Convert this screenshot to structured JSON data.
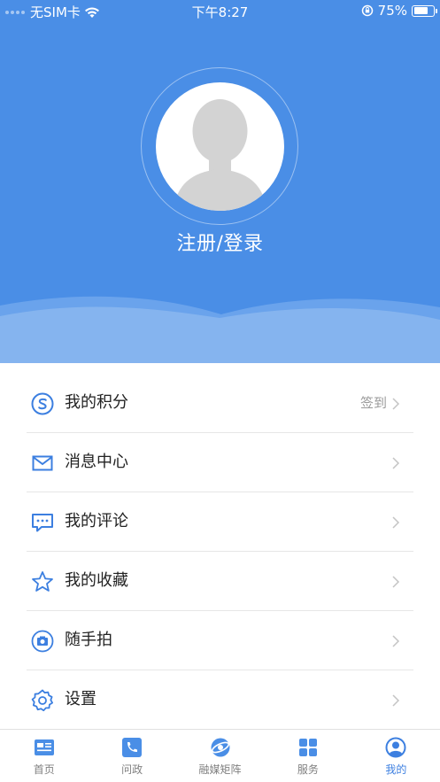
{
  "status_bar": {
    "carrier": "无SIM卡",
    "time": "下午8:27",
    "battery": "75%",
    "battery_level": 0.75
  },
  "profile": {
    "login_label": "注册/登录"
  },
  "menu": {
    "items": [
      {
        "label": "我的积分",
        "extra": "签到",
        "icon": "points-icon"
      },
      {
        "label": "消息中心",
        "extra": "",
        "icon": "mail-icon"
      },
      {
        "label": "我的评论",
        "extra": "",
        "icon": "comment-icon"
      },
      {
        "label": "我的收藏",
        "extra": "",
        "icon": "star-icon"
      },
      {
        "label": "随手拍",
        "extra": "",
        "icon": "camera-icon"
      },
      {
        "label": "设置",
        "extra": "",
        "icon": "gear-icon"
      }
    ]
  },
  "tabbar": {
    "tabs": [
      {
        "label": "首页",
        "icon": "home-news-icon",
        "active": false
      },
      {
        "label": "问政",
        "icon": "phone-icon",
        "active": false
      },
      {
        "label": "融媒矩阵",
        "icon": "globe-icon",
        "active": false
      },
      {
        "label": "服务",
        "icon": "grid-icon",
        "active": false
      },
      {
        "label": "我的",
        "icon": "user-icon",
        "active": true
      }
    ]
  },
  "colors": {
    "primary": "#4a8ee6",
    "accent_icon": "#3c7fe0",
    "tab_inactive": "#808080"
  }
}
